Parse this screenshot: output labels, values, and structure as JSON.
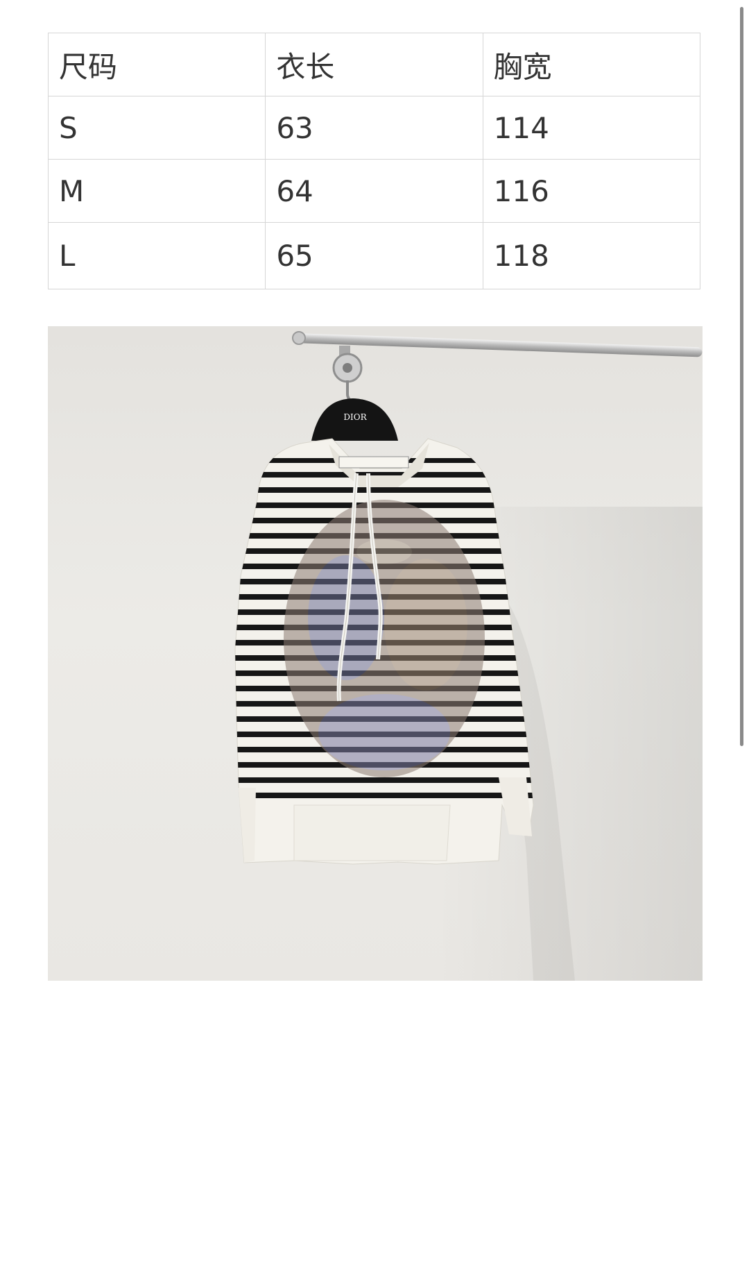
{
  "size_table": {
    "header": [
      "尺码",
      "衣长",
      "胸宽"
    ],
    "rows": [
      [
        "S",
        "63",
        "114"
      ],
      [
        "M",
        "64",
        "116"
      ],
      [
        "L",
        "65",
        "118"
      ]
    ]
  },
  "photo": {
    "hanger_brand": "DIOR",
    "colors": {
      "wall": "#e8e6e2",
      "stripe": "#1a1a1a",
      "knit": "#f4f2ec"
    }
  }
}
